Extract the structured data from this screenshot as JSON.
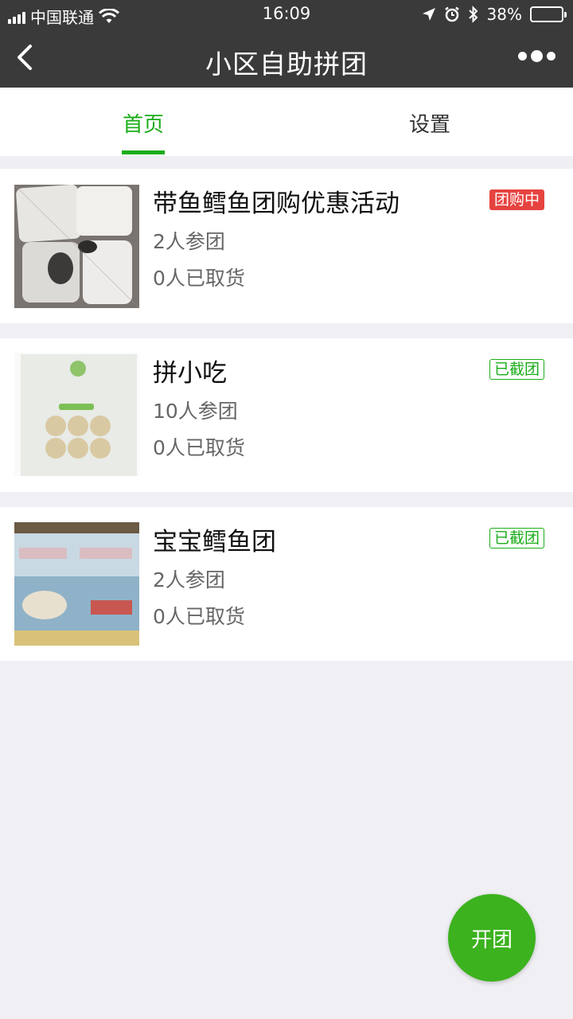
{
  "status_bar": {
    "carrier": "中国联通",
    "time": "16:09",
    "battery": "38%",
    "battery_level": 0.38,
    "icons": [
      "signal-icon",
      "wifi-icon",
      "location-arrow-icon",
      "alarm-icon",
      "bluetooth-icon",
      "battery-icon"
    ]
  },
  "nav": {
    "title": "小区自助拼团",
    "back_icon": "back-chevron-icon",
    "more_icon": "more-dots-icon"
  },
  "tabs": [
    {
      "label": "首页",
      "active": true
    },
    {
      "label": "设置",
      "active": false
    }
  ],
  "colors": {
    "accent": "#1aad19",
    "badge_active": "#e64340",
    "nav_bg": "#3a3a3a",
    "page_bg": "#efeff4",
    "fab": "#3cb21e"
  },
  "groups": [
    {
      "title": "带鱼鳕鱼团购优惠活动",
      "participants": "2人参团",
      "picked_up": "0人已取货",
      "status": "团购中",
      "status_type": "active"
    },
    {
      "title": "拼小吃",
      "participants": "10人参团",
      "picked_up": "0人已取货",
      "status": "已截团",
      "status_type": "closed"
    },
    {
      "title": "宝宝鳕鱼团",
      "participants": "2人参团",
      "picked_up": "0人已取货",
      "status": "已截团",
      "status_type": "closed"
    }
  ],
  "fab": {
    "label": "开团"
  }
}
